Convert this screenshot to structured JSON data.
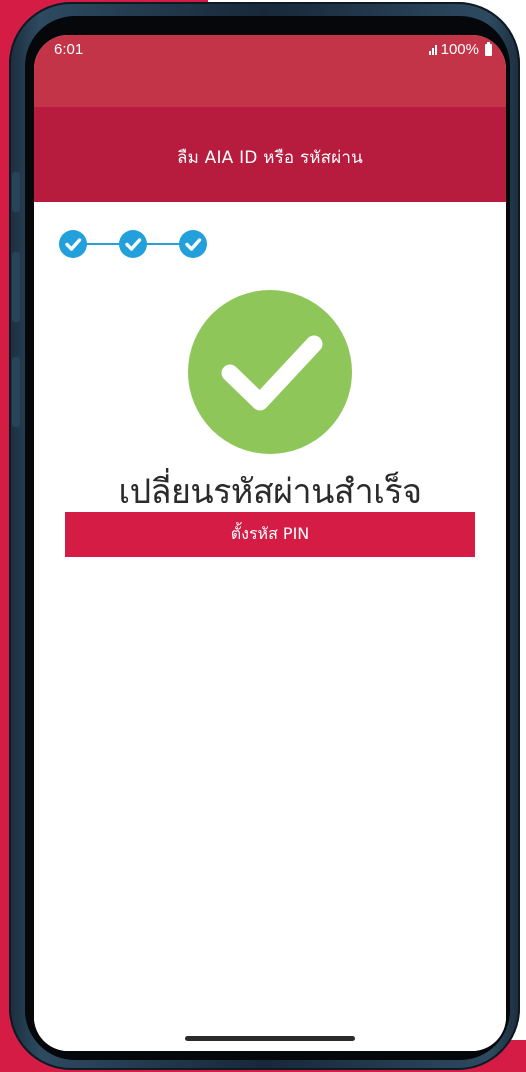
{
  "status_bar": {
    "time": "6:01",
    "battery": "100%",
    "signal_icon": "signal-bars-icon",
    "battery_icon": "battery-icon"
  },
  "header": {
    "title": "ลืม AIA ID หรือ รหัสผ่าน"
  },
  "stepper": {
    "steps": [
      {
        "state": "completed",
        "icon": "check-icon"
      },
      {
        "state": "completed",
        "icon": "check-icon"
      },
      {
        "state": "completed",
        "icon": "check-icon"
      }
    ]
  },
  "result": {
    "icon": "success-check-icon",
    "title": "เปลี่ยนรหัสผ่านสำเร็จ"
  },
  "actions": {
    "set_pin_label": "ตั้งรหัส PIN"
  },
  "colors": {
    "brand_red": "#d41c45",
    "header_red": "#b71b3e",
    "status_red": "#c33449",
    "step_blue": "#22a0dc",
    "success_green": "#8fc65a"
  }
}
